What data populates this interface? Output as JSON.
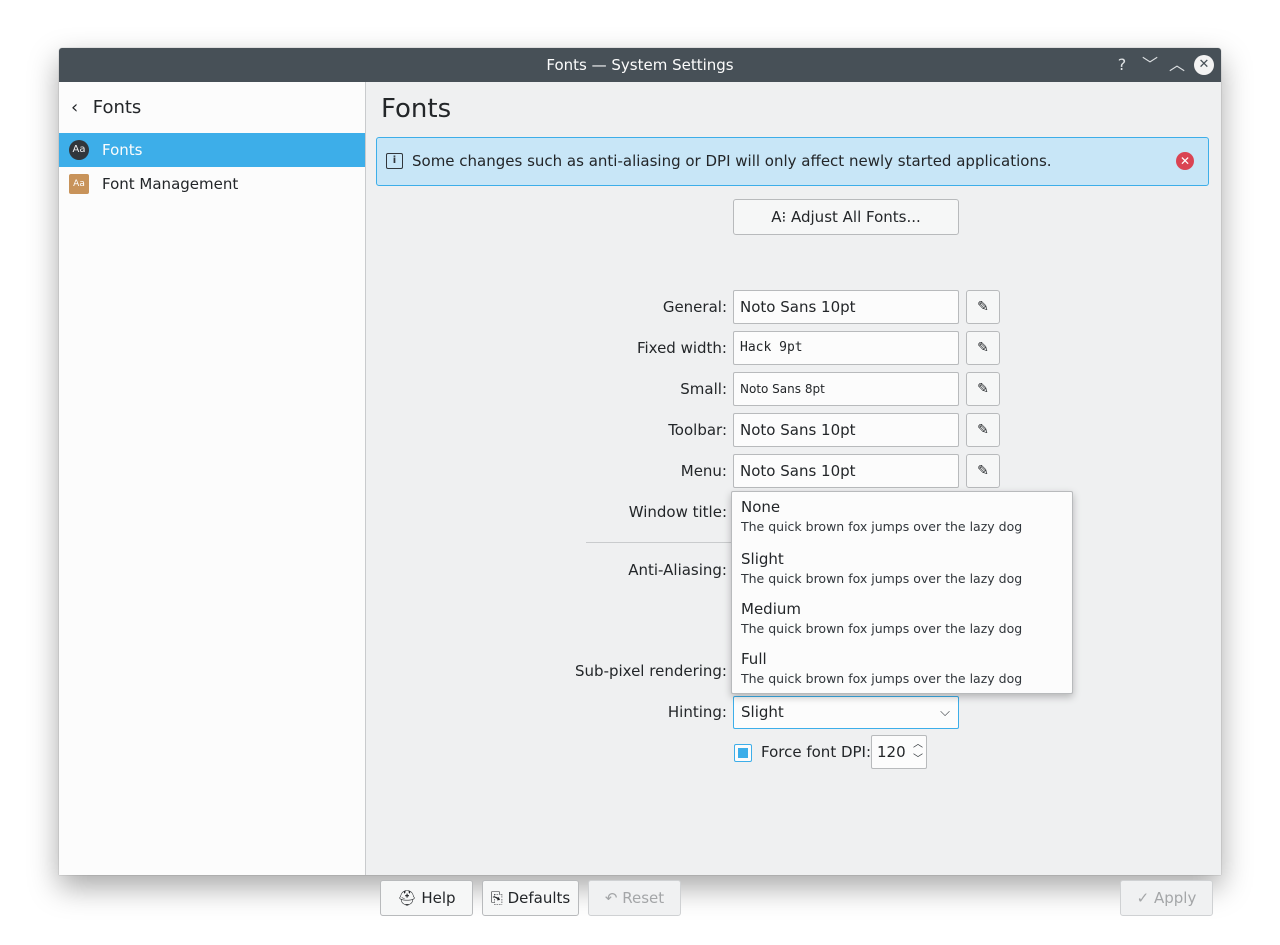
{
  "window": {
    "title": "Fonts — System Settings",
    "help_label": "?",
    "minimize_label": "﹀",
    "maximize_label": "︿",
    "close_label": "✕"
  },
  "sidebar": {
    "back_chevron": "‹",
    "header": "Fonts",
    "items": [
      {
        "label": "Fonts",
        "icon": "Aa",
        "active": true
      },
      {
        "label": "Font Management",
        "icon": "Aa",
        "active": false
      }
    ]
  },
  "main": {
    "title": "Fonts",
    "banner": {
      "message": "Some changes such as anti-aliasing or DPI will only affect newly started applications.",
      "info_glyph": "i",
      "close_glyph": "✕"
    },
    "adjust_all": {
      "icon": "A⁝",
      "label": "Adjust All Fonts..."
    },
    "fonts": [
      {
        "label": "General:",
        "value": "Noto Sans 10pt"
      },
      {
        "label": "Fixed width:",
        "value": "Hack 9pt"
      },
      {
        "label": "Small:",
        "value": "Noto Sans 8pt"
      },
      {
        "label": "Toolbar:",
        "value": "Noto Sans 10pt"
      },
      {
        "label": "Menu:",
        "value": "Noto Sans 10pt"
      },
      {
        "label": "Window title:"
      }
    ],
    "pencil_glyph": "✎",
    "anti_aliasing_label": "Anti-Aliasing:",
    "subpixel_label": "Sub-pixel rendering:",
    "hinting": {
      "label": "Hinting:",
      "value": "Slight",
      "arrow": "⌵"
    },
    "force_dpi": {
      "label": "Force font DPI:",
      "checked": true,
      "value": "120",
      "up": "︿",
      "down": "﹀"
    },
    "hinting_dropdown": [
      {
        "name": "None",
        "sample": "The quick brown fox jumps over the lazy dog"
      },
      {
        "name": "Slight",
        "sample": "The quick brown fox jumps over the lazy dog"
      },
      {
        "name": "Medium",
        "sample": "The quick brown fox jumps over the lazy dog"
      },
      {
        "name": "Full",
        "sample": "The quick brown fox jumps over the lazy dog"
      }
    ]
  },
  "footer": {
    "help": {
      "icon": "⛑",
      "label": "Help"
    },
    "defaults": {
      "icon": "⎘",
      "label": "Defaults"
    },
    "reset": {
      "icon": "↶",
      "label": "Reset"
    },
    "apply": {
      "icon": "✓",
      "label": "Apply"
    }
  },
  "colors": {
    "accent": "#3daee9",
    "titlebar": "#475057",
    "banner_bg": "#c8e6f7",
    "close_red": "#da4453"
  }
}
